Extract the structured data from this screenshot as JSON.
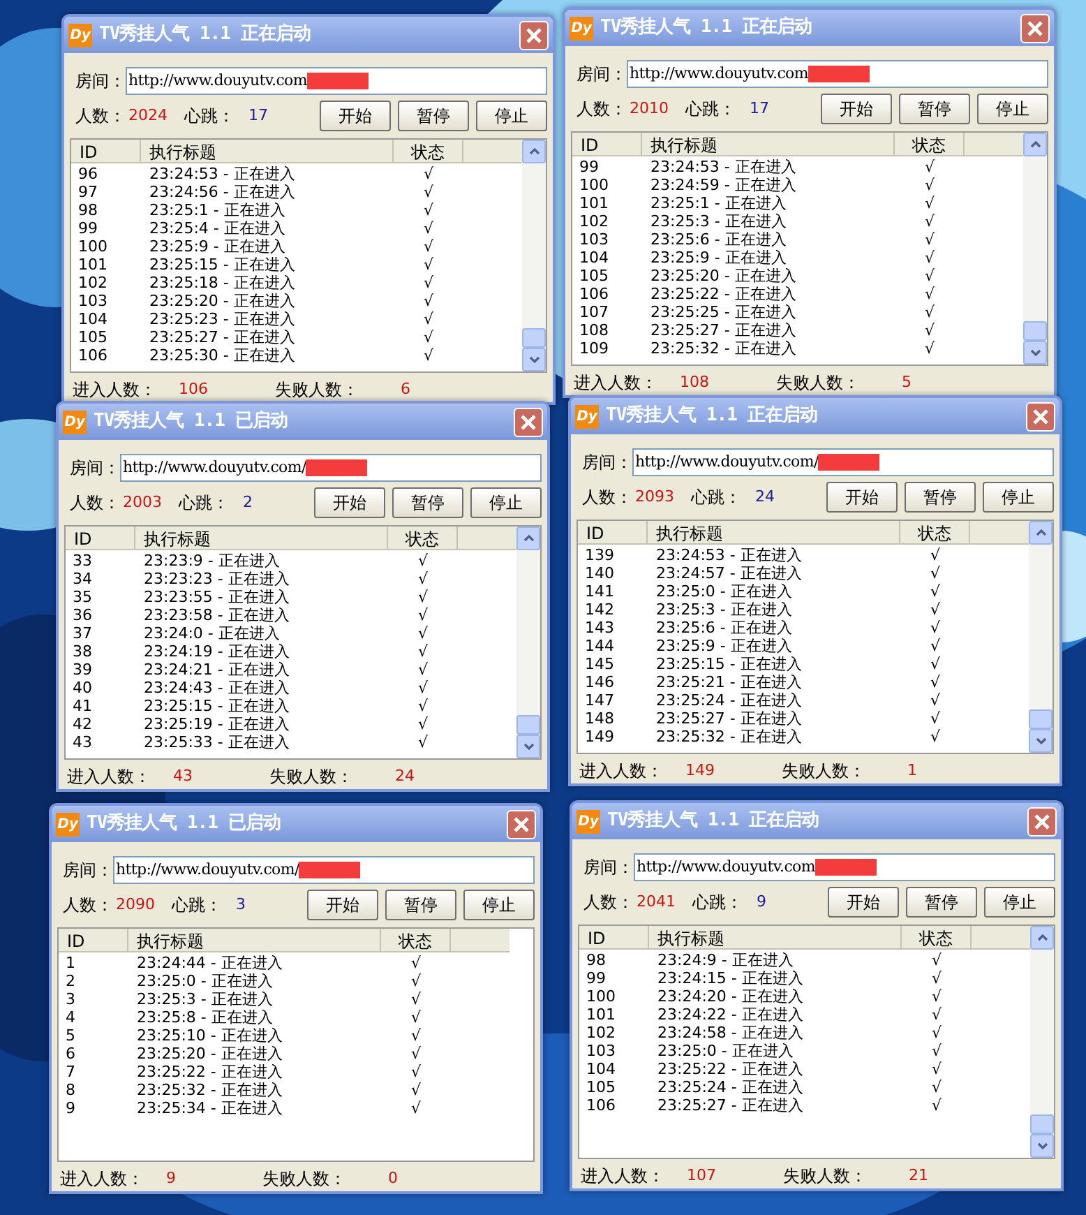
{
  "windows": [
    {
      "logo": "Dy",
      "title": "TV秀挂人气 1.1 正在启动",
      "room_label": "房间：",
      "room_url": "http://www.douyutv.com",
      "count_label": "人数：",
      "count": "2024",
      "heartbeat_label": "心跳：",
      "heartbeat": "17",
      "buttons": [
        "开始",
        "暂停",
        "停止"
      ],
      "columns": [
        "ID",
        "执行标题",
        "状态"
      ],
      "scrollbar": true,
      "rows": [
        {
          "id": "96",
          "title": "23:24:53 - 正在进入",
          "status": "√"
        },
        {
          "id": "97",
          "title": "23:24:56 - 正在进入",
          "status": "√"
        },
        {
          "id": "98",
          "title": "23:25:1 - 正在进入",
          "status": "√"
        },
        {
          "id": "99",
          "title": "23:25:4 - 正在进入",
          "status": "√"
        },
        {
          "id": "100",
          "title": "23:25:9 - 正在进入",
          "status": "√"
        },
        {
          "id": "101",
          "title": "23:25:15 - 正在进入",
          "status": "√"
        },
        {
          "id": "102",
          "title": "23:25:18 - 正在进入",
          "status": "√"
        },
        {
          "id": "103",
          "title": "23:25:20 - 正在进入",
          "status": "√"
        },
        {
          "id": "104",
          "title": "23:25:23 - 正在进入",
          "status": "√"
        },
        {
          "id": "105",
          "title": "23:25:27 - 正在进入",
          "status": "√"
        },
        {
          "id": "106",
          "title": "23:25:30 - 正在进入",
          "status": "√"
        }
      ],
      "entered_label": "进入人数：",
      "entered": "106",
      "failed_label": "失败人数：",
      "failed": "6"
    },
    {
      "logo": "Dy",
      "title": "TV秀挂人气 1.1 正在启动",
      "room_label": "房间：",
      "room_url": "http://www.douyutv.com",
      "count_label": "人数：",
      "count": "2010",
      "heartbeat_label": "心跳：",
      "heartbeat": "17",
      "buttons": [
        "开始",
        "暂停",
        "停止"
      ],
      "columns": [
        "ID",
        "执行标题",
        "状态"
      ],
      "scrollbar": true,
      "rows": [
        {
          "id": "99",
          "title": "23:24:53 - 正在进入",
          "status": "√"
        },
        {
          "id": "100",
          "title": "23:24:59 - 正在进入",
          "status": "√"
        },
        {
          "id": "101",
          "title": "23:25:1 - 正在进入",
          "status": "√"
        },
        {
          "id": "102",
          "title": "23:25:3 - 正在进入",
          "status": "√"
        },
        {
          "id": "103",
          "title": "23:25:6 - 正在进入",
          "status": "√"
        },
        {
          "id": "104",
          "title": "23:25:9 - 正在进入",
          "status": "√"
        },
        {
          "id": "105",
          "title": "23:25:20 - 正在进入",
          "status": "√"
        },
        {
          "id": "106",
          "title": "23:25:22 - 正在进入",
          "status": "√"
        },
        {
          "id": "107",
          "title": "23:25:25 - 正在进入",
          "status": "√"
        },
        {
          "id": "108",
          "title": "23:25:27 - 正在进入",
          "status": "√"
        },
        {
          "id": "109",
          "title": "23:25:32 - 正在进入",
          "status": "√"
        }
      ],
      "entered_label": "进入人数：",
      "entered": "108",
      "failed_label": "失败人数：",
      "failed": "5"
    },
    {
      "logo": "Dy",
      "title": "TV秀挂人气 1.1 已启动",
      "room_label": "房间：",
      "room_url": "http://www.douyutv.com/",
      "count_label": "人数：",
      "count": "2003",
      "heartbeat_label": "心跳：",
      "heartbeat": "2",
      "buttons": [
        "开始",
        "暂停",
        "停止"
      ],
      "columns": [
        "ID",
        "执行标题",
        "状态"
      ],
      "scrollbar": true,
      "rows": [
        {
          "id": "33",
          "title": "23:23:9 - 正在进入",
          "status": "√"
        },
        {
          "id": "34",
          "title": "23:23:23 - 正在进入",
          "status": "√"
        },
        {
          "id": "35",
          "title": "23:23:55 - 正在进入",
          "status": "√"
        },
        {
          "id": "36",
          "title": "23:23:58 - 正在进入",
          "status": "√"
        },
        {
          "id": "37",
          "title": "23:24:0 - 正在进入",
          "status": "√"
        },
        {
          "id": "38",
          "title": "23:24:19 - 正在进入",
          "status": "√"
        },
        {
          "id": "39",
          "title": "23:24:21 - 正在进入",
          "status": "√"
        },
        {
          "id": "40",
          "title": "23:24:43 - 正在进入",
          "status": "√"
        },
        {
          "id": "41",
          "title": "23:25:15 - 正在进入",
          "status": "√"
        },
        {
          "id": "42",
          "title": "23:25:19 - 正在进入",
          "status": "√"
        },
        {
          "id": "43",
          "title": "23:25:33 - 正在进入",
          "status": "√"
        }
      ],
      "entered_label": "进入人数：",
      "entered": "43",
      "failed_label": "失败人数：",
      "failed": "24"
    },
    {
      "logo": "Dy",
      "title": "TV秀挂人气 1.1 正在启动",
      "room_label": "房间：",
      "room_url": "http://www.douyutv.com/",
      "count_label": "人数：",
      "count": "2093",
      "heartbeat_label": "心跳：",
      "heartbeat": "24",
      "buttons": [
        "开始",
        "暂停",
        "停止"
      ],
      "columns": [
        "ID",
        "执行标题",
        "状态"
      ],
      "scrollbar": true,
      "rows": [
        {
          "id": "139",
          "title": "23:24:53 - 正在进入",
          "status": "√"
        },
        {
          "id": "140",
          "title": "23:24:57 - 正在进入",
          "status": "√"
        },
        {
          "id": "141",
          "title": "23:25:0 - 正在进入",
          "status": "√"
        },
        {
          "id": "142",
          "title": "23:25:3 - 正在进入",
          "status": "√"
        },
        {
          "id": "143",
          "title": "23:25:6 - 正在进入",
          "status": "√"
        },
        {
          "id": "144",
          "title": "23:25:9 - 正在进入",
          "status": "√"
        },
        {
          "id": "145",
          "title": "23:25:15 - 正在进入",
          "status": "√"
        },
        {
          "id": "146",
          "title": "23:25:21 - 正在进入",
          "status": "√"
        },
        {
          "id": "147",
          "title": "23:25:24 - 正在进入",
          "status": "√"
        },
        {
          "id": "148",
          "title": "23:25:27 - 正在进入",
          "status": "√"
        },
        {
          "id": "149",
          "title": "23:25:32 - 正在进入",
          "status": "√"
        }
      ],
      "entered_label": "进入人数：",
      "entered": "149",
      "failed_label": "失败人数：",
      "failed": "1"
    },
    {
      "logo": "Dy",
      "title": "TV秀挂人气 1.1 已启动",
      "room_label": "房间：",
      "room_url": "http://www.douyutv.com/",
      "count_label": "人数：",
      "count": "2090",
      "heartbeat_label": "心跳：",
      "heartbeat": "3",
      "buttons": [
        "开始",
        "暂停",
        "停止"
      ],
      "columns": [
        "ID",
        "执行标题",
        "状态"
      ],
      "scrollbar": false,
      "rows": [
        {
          "id": "1",
          "title": "23:24:44 - 正在进入",
          "status": "√"
        },
        {
          "id": "2",
          "title": "23:25:0 - 正在进入",
          "status": "√"
        },
        {
          "id": "3",
          "title": "23:25:3 - 正在进入",
          "status": "√"
        },
        {
          "id": "4",
          "title": "23:25:8 - 正在进入",
          "status": "√"
        },
        {
          "id": "5",
          "title": "23:25:10 - 正在进入",
          "status": "√"
        },
        {
          "id": "6",
          "title": "23:25:20 - 正在进入",
          "status": "√"
        },
        {
          "id": "7",
          "title": "23:25:22 - 正在进入",
          "status": "√"
        },
        {
          "id": "8",
          "title": "23:25:32 - 正在进入",
          "status": "√"
        },
        {
          "id": "9",
          "title": "23:25:34 - 正在进入",
          "status": "√"
        }
      ],
      "entered_label": "进入人数：",
      "entered": "9",
      "failed_label": "失败人数：",
      "failed": "0"
    },
    {
      "logo": "Dy",
      "title": "TV秀挂人气 1.1 正在启动",
      "room_label": "房间：",
      "room_url": "http://www.douyutv.com",
      "count_label": "人数：",
      "count": "2041",
      "heartbeat_label": "心跳：",
      "heartbeat": "9",
      "buttons": [
        "开始",
        "暂停",
        "停止"
      ],
      "columns": [
        "ID",
        "执行标题",
        "状态"
      ],
      "scrollbar": true,
      "rows": [
        {
          "id": "98",
          "title": "23:24:9 - 正在进入",
          "status": "√"
        },
        {
          "id": "99",
          "title": "23:24:15 - 正在进入",
          "status": "√"
        },
        {
          "id": "100",
          "title": "23:24:20 - 正在进入",
          "status": "√"
        },
        {
          "id": "101",
          "title": "23:24:22 - 正在进入",
          "status": "√"
        },
        {
          "id": "102",
          "title": "23:24:58 - 正在进入",
          "status": "√"
        },
        {
          "id": "103",
          "title": "23:25:0 - 正在进入",
          "status": "√"
        },
        {
          "id": "104",
          "title": "23:25:22 - 正在进入",
          "status": "√"
        },
        {
          "id": "105",
          "title": "23:25:24 - 正在进入",
          "status": "√"
        },
        {
          "id": "106",
          "title": "23:25:27 - 正在进入",
          "status": "√"
        }
      ],
      "entered_label": "进入人数：",
      "entered": "107",
      "failed_label": "失败人数：",
      "failed": "21"
    }
  ]
}
